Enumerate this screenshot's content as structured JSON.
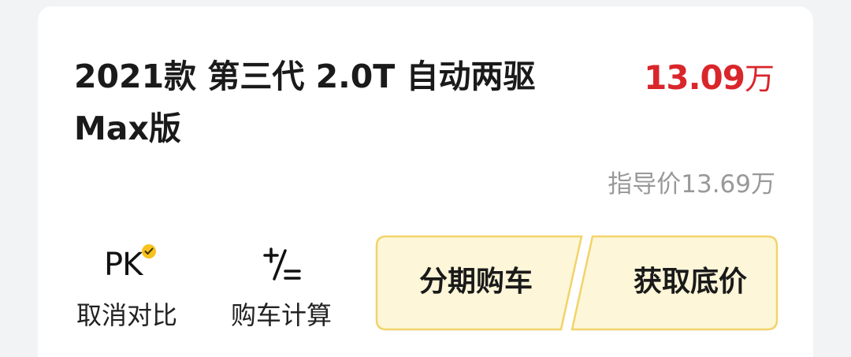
{
  "car": {
    "title": "2021款 第三代 2.0T 自动两驱 Max版",
    "price_value": "13.09",
    "price_unit": "万",
    "guide_price": "指导价13.69万"
  },
  "tools": {
    "pk": {
      "icon": "pk-check-icon",
      "glyph": "PK",
      "label": "取消对比"
    },
    "calc": {
      "icon": "plus-minus-equals-icon",
      "label": "购车计算"
    }
  },
  "actions": {
    "installment": "分期购车",
    "lowest_price": "获取底价"
  },
  "colors": {
    "price_red": "#d9262b",
    "button_fill": "#fdf6d8",
    "button_border": "#f2d36a",
    "check_yellow": "#f6c21c"
  }
}
